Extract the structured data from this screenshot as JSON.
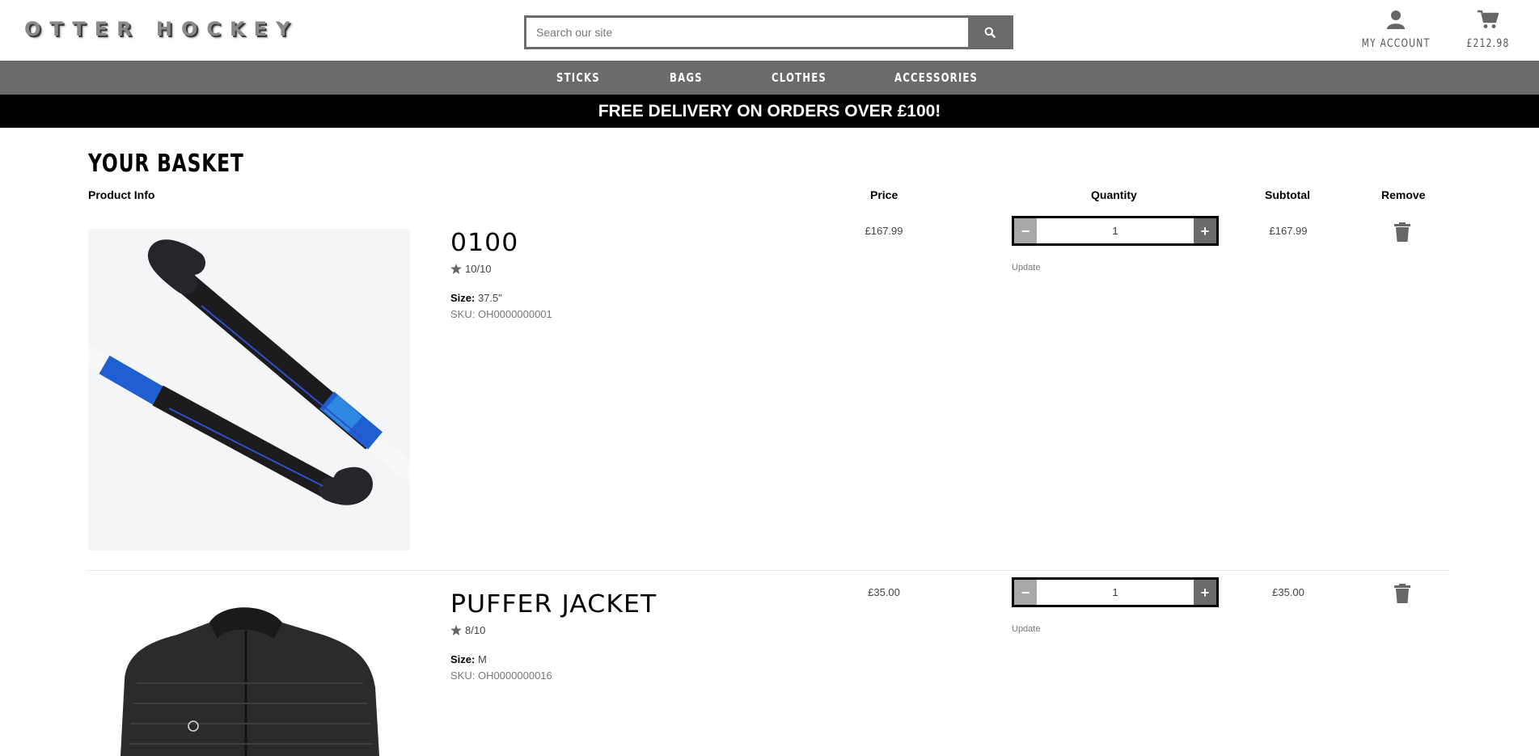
{
  "header": {
    "logo": "OTTER HOCKEY",
    "search_placeholder": "Search our site",
    "account_label": "MY ACCOUNT",
    "basket_total": "£212.98"
  },
  "nav": {
    "items": [
      {
        "label": "STICKS"
      },
      {
        "label": "BAGS"
      },
      {
        "label": "CLOTHES"
      },
      {
        "label": "ACCESSORIES"
      }
    ]
  },
  "banner": {
    "text": "FREE DELIVERY ON ORDERS OVER £100!"
  },
  "basket": {
    "title": "YOUR BASKET",
    "columns": {
      "product_info": "Product Info",
      "price": "Price",
      "quantity": "Quantity",
      "subtotal": "Subtotal",
      "remove": "Remove"
    },
    "items": [
      {
        "name": "0100",
        "rating": "10/10",
        "size_label": "Size:",
        "size_value": "37.5\"",
        "sku": "SKU: OH0000000001",
        "price": "£167.99",
        "quantity": "1",
        "update_label": "Update",
        "subtotal": "£167.99"
      },
      {
        "name": "PUFFER JACKET",
        "rating": "8/10",
        "size_label": "Size:",
        "size_value": "M",
        "sku": "SKU: OH0000000016",
        "price": "£35.00",
        "quantity": "1",
        "update_label": "Update",
        "subtotal": "£35.00"
      }
    ]
  },
  "colors": {
    "brand_grey": "#6b6b6b",
    "banner_bg": "#000000",
    "stick_blue": "#1f5fd1"
  },
  "icons": [
    "search-icon",
    "user-icon",
    "cart-icon",
    "star-icon",
    "trash-icon",
    "minus-icon",
    "plus-icon"
  ]
}
